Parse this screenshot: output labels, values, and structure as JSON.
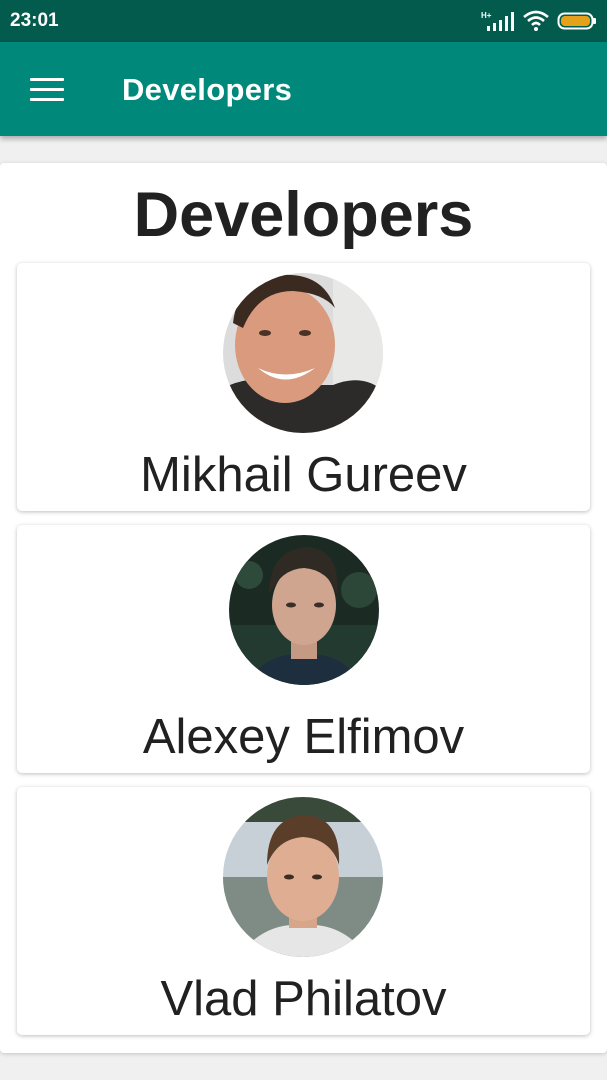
{
  "status_bar": {
    "time": "23:01",
    "signal_label": "H+",
    "icons": [
      "signal-icon",
      "wifi-icon",
      "battery-icon"
    ],
    "battery_color": "#e3a21a"
  },
  "app_bar": {
    "title": "Developers",
    "menu_icon": "hamburger-menu-icon",
    "background": "#00897b"
  },
  "page": {
    "heading": "Developers"
  },
  "developers": [
    {
      "name": "Mikhail Gureev",
      "avatar": "avatar-photo"
    },
    {
      "name": "Alexey Elfimov",
      "avatar": "avatar-photo"
    },
    {
      "name": "Vlad Philatov",
      "avatar": "avatar-photo"
    }
  ]
}
